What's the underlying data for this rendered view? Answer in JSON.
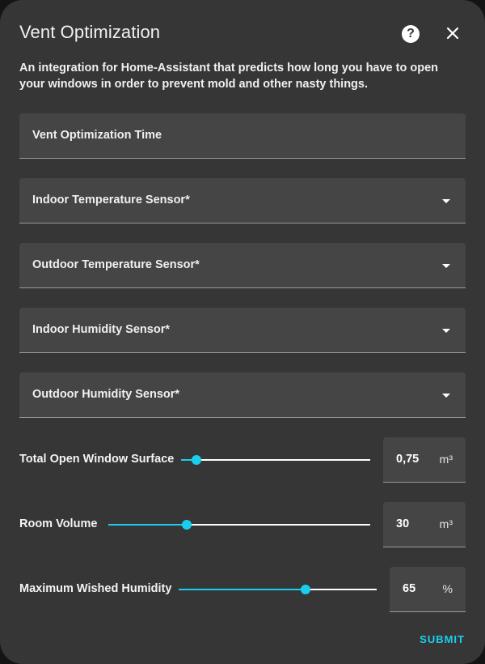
{
  "dialog": {
    "title": "Vent Optimization",
    "description": "An integration for Home-Assistant that predicts how long you have to open your windows in order to prevent mold and other nasty things.",
    "help_icon": "help-circle-icon",
    "close_icon": "close-icon",
    "accent_color": "#18d0ee"
  },
  "fields": {
    "name_field": {
      "label": "Vent Optimization Time"
    },
    "indoor_temp": {
      "label": "Indoor Temperature Sensor*"
    },
    "outdoor_temp": {
      "label": "Outdoor Temperature Sensor*"
    },
    "indoor_humidity": {
      "label": "Indoor Humidity Sensor*"
    },
    "outdoor_humidity": {
      "label": "Outdoor Humidity Sensor*"
    }
  },
  "sliders": {
    "window_surface": {
      "label": "Total Open Window Surface",
      "value": "0,75",
      "unit": "m³",
      "fraction": 0.08
    },
    "room_volume": {
      "label": "Room Volume",
      "value": "30",
      "unit": "m³",
      "fraction": 0.3
    },
    "max_humidity": {
      "label": "Maximum Wished Humidity",
      "value": "65",
      "unit": "%",
      "fraction": 0.64
    }
  },
  "actions": {
    "submit_label": "SUBMIT"
  }
}
